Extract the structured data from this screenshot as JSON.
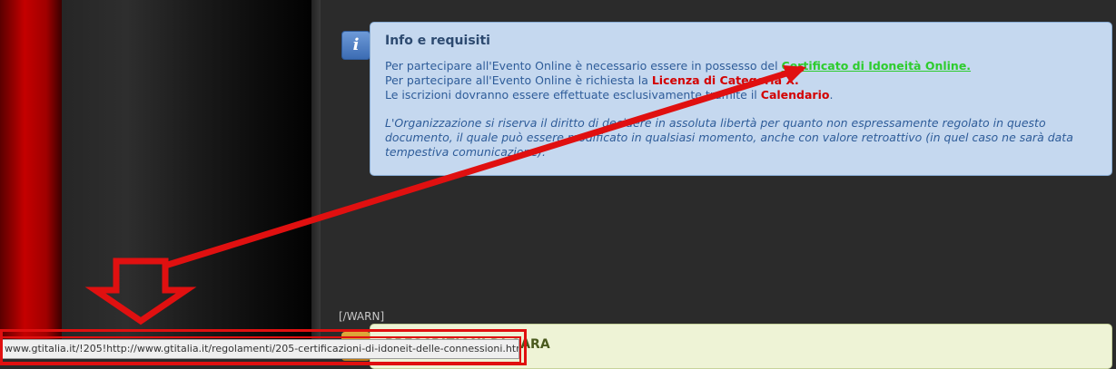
{
  "info": {
    "icon_letter": "i",
    "title": "Info e requisiti",
    "line1_text": "Per partecipare all'Evento Online è necessario essere in possesso del ",
    "line1_link": "Certificato di Idoneità Online.",
    "line2_text": "Per partecipare all'Evento Online è richiesta la ",
    "line2_link": "Licenza di Categoria X.",
    "line3_text": "Le iscrizioni dovranno essere effettuate esclusivamente tramite il ",
    "line3_link": "Calendario",
    "line3_end": ".",
    "disclaimer": "L'Organizzazione si riserva il diritto di decidere in assoluta libertà per quanto non espressamente regolato in questo documento, il quale può essere modificato in qualsiasi momento, anche con valore retroattivo (in quel caso ne sarà data tempestiva comunicazione)."
  },
  "warn_tag": "[/WARN]",
  "section_title": "PRESCRIZIONI DI GARA",
  "status_url": "www.gtitalia.it/!205!http://www.gtitalia.it/regolamenti/205-certificazioni-di-idoneit-delle-connessioni.html",
  "colors": {
    "annotation": "#e01010",
    "link_green": "#2ecc2e",
    "link_red": "#d30000",
    "info_bg": "#c5d8ef"
  }
}
